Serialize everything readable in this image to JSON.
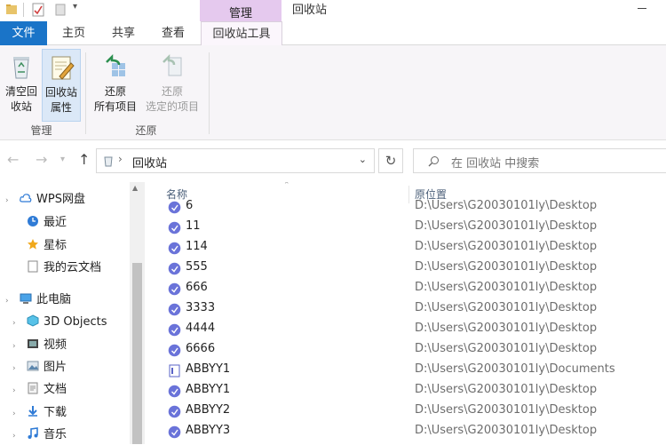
{
  "titlebar": {
    "context_tab": "管理",
    "window_title": "回收站"
  },
  "ribbon_tabs": {
    "file": "文件",
    "home": "主页",
    "share": "共享",
    "view": "查看",
    "recycle_tools": "回收站工具"
  },
  "ribbon": {
    "empty_bin": [
      "清空回",
      "收站"
    ],
    "properties": [
      "回收站",
      "属性"
    ],
    "restore_all": [
      "还原",
      "所有项目"
    ],
    "restore_selected": [
      "还原",
      "选定的项目"
    ],
    "group_manage": "管理",
    "group_restore": "还原"
  },
  "address": {
    "path": "回收站",
    "search_placeholder": "在 回收站 中搜索"
  },
  "nav": {
    "wps": "WPS网盘",
    "recent": "最近",
    "starred": "星标",
    "cloud_docs": "我的云文档",
    "this_pc": "此电脑",
    "objects3d": "3D Objects",
    "videos": "视频",
    "pictures": "图片",
    "documents": "文档",
    "downloads": "下载",
    "music": "音乐"
  },
  "columns": {
    "name": "名称",
    "location": "原位置"
  },
  "files": [
    {
      "name": "6",
      "location": "D:\\Users\\G20030101ly\\Desktop",
      "icon": "blue-doc-icon"
    },
    {
      "name": "11",
      "location": "D:\\Users\\G20030101ly\\Desktop",
      "icon": "blue-doc-icon"
    },
    {
      "name": "114",
      "location": "D:\\Users\\G20030101ly\\Desktop",
      "icon": "blue-doc-icon"
    },
    {
      "name": "555",
      "location": "D:\\Users\\G20030101ly\\Desktop",
      "icon": "blue-doc-icon"
    },
    {
      "name": "666",
      "location": "D:\\Users\\G20030101ly\\Desktop",
      "icon": "blue-doc-icon"
    },
    {
      "name": "3333",
      "location": "D:\\Users\\G20030101ly\\Desktop",
      "icon": "blue-doc-icon"
    },
    {
      "name": "4444",
      "location": "D:\\Users\\G20030101ly\\Desktop",
      "icon": "blue-doc-icon"
    },
    {
      "name": "6666",
      "location": "D:\\Users\\G20030101ly\\Desktop",
      "icon": "blue-doc-icon"
    },
    {
      "name": "ABBYY1",
      "location": "D:\\Users\\G20030101ly\\Documents",
      "icon": "abbyy-doc-icon"
    },
    {
      "name": "ABBYY1",
      "location": "D:\\Users\\G20030101ly\\Desktop",
      "icon": "blue-doc-icon"
    },
    {
      "name": "ABBYY2",
      "location": "D:\\Users\\G20030101ly\\Desktop",
      "icon": "blue-doc-icon"
    },
    {
      "name": "ABBYY3",
      "location": "D:\\Users\\G20030101ly\\Desktop",
      "icon": "blue-doc-icon"
    }
  ],
  "colors": {
    "accent": "#1a74c8",
    "context_tab": "#e5c9ee",
    "file_icon": "#6a73d9"
  }
}
